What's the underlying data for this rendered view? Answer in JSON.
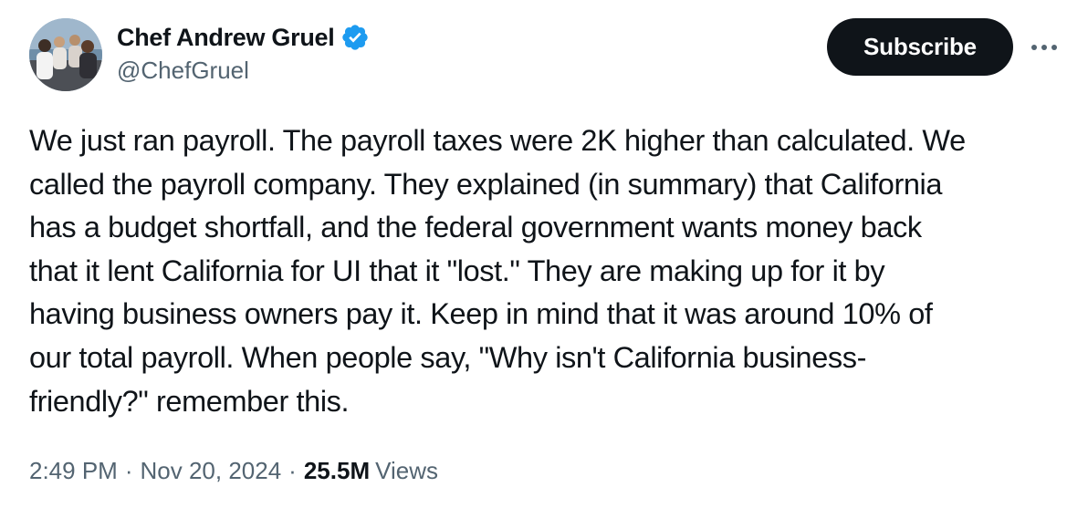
{
  "author": {
    "name": "Chef Andrew Gruel",
    "handle": "@ChefGruel",
    "verified": true
  },
  "actions": {
    "subscribe_label": "Subscribe",
    "more_icon": "more-horizontal-icon"
  },
  "tweet": {
    "lines": [
      "We just ran payroll. The payroll taxes were 2K higher than calculated. We",
      "called the payroll company. They explained (in summary) that California",
      "has a budget shortfall, and the federal government wants money back",
      "that it lent California for UI that it \"lost.\" They are making up for it by",
      "having business owners pay it. Keep in mind that it was around 10% of",
      "our total payroll. When people say, \"Why isn't California business-",
      "friendly?\" remember this."
    ]
  },
  "meta": {
    "time": "2:49 PM",
    "separator": "·",
    "date": "Nov 20, 2024",
    "views_count": "25.5M",
    "views_label": "Views"
  },
  "colors": {
    "text_primary": "#0f1419",
    "text_secondary": "#536471",
    "verified_blue": "#1d9bf0",
    "button_bg": "#0f1419"
  }
}
